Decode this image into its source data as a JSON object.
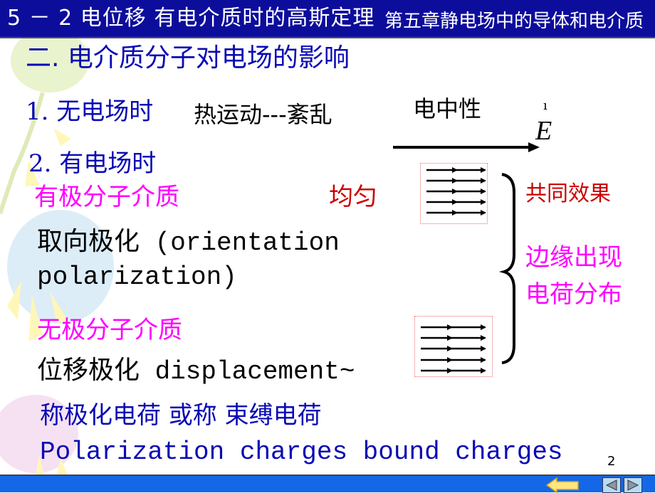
{
  "header": {
    "section_title": "5 － 2 电位移 有电介质时的高斯定理",
    "chapter_title": "第五章静电场中的导体和电介质"
  },
  "content": {
    "heading": "二. 电介质分子对电场的影响",
    "item1_label": "1. 无电场时",
    "item1_desc": "热运动---紊乱",
    "neutral_label": "电中性",
    "field_symbol": "E",
    "field_vector_mark": "ı",
    "item2_label": "2. 有电场时",
    "polar_label": "有极分子介质",
    "uniform_label": "均匀",
    "orientation_line1": "取向极化 (orientation",
    "orientation_line2": "polarization)",
    "nonpolar_label": "无极分子介质",
    "displacement_text": "位移极化 displacement~",
    "common_effect": "共同效果",
    "edge_line1": "边缘出现",
    "edge_line2": "电荷分布",
    "charges_cn": "称极化电荷 或称   束缚电荷",
    "charges_en": "Polarization  charges   bound charges"
  },
  "footer": {
    "page_number": "2",
    "back_icon": "return-arrow-icon",
    "prev_icon": "triangle-left-icon",
    "next_icon": "triangle-right-icon"
  },
  "colors": {
    "title_bar": "#0d0d9c",
    "heading_blue": "#0a0ab4",
    "magenta": "#ff00ff",
    "red": "#cc0000",
    "bottom_bar": "#1467e6"
  }
}
